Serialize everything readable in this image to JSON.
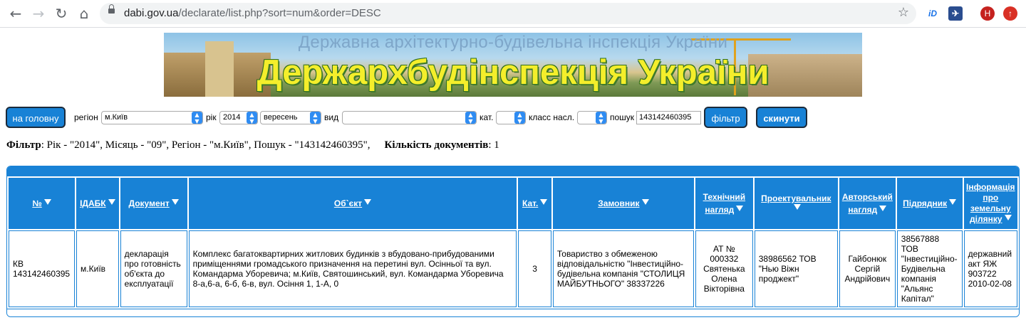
{
  "browser": {
    "url_host": "dabi.gov.ua",
    "url_path": "/declarate/list.php?sort=num&order=DESC",
    "ext_id": "iD",
    "ext_avatar": "H"
  },
  "banner": {
    "line1": "Державна архітектурно-будівельна інспекція України",
    "line2": "Держархбудінспекція України"
  },
  "filter_bar": {
    "home_button": "на головну",
    "region_label": "регіон",
    "region_value": "м.Київ",
    "year_label": "рік",
    "year_value": "2014",
    "month_value": "вересень",
    "kind_label": "вид",
    "kind_value": "",
    "cat_label": "кат.",
    "cat_value": "",
    "class_label": "класс насл.",
    "class_value": "",
    "search_label": "пошук",
    "search_value": "143142460395",
    "filter_button": "фільтр",
    "reset_button": "скинути"
  },
  "summary": {
    "filter_label": "Фільтр",
    "filter_text": ": Рік - \"2014\", Місяць - \"09\", Регіон - \"м.Київ\", Пошук - \"143142460395\",",
    "count_label": "Кількість документів",
    "count_text": ": 1"
  },
  "table": {
    "headers": [
      "№",
      "ІДАБК",
      "Документ",
      "Об`єкт",
      "Кат.",
      "Замовник",
      "Технічний нагляд",
      "Проектувальник",
      "Авторський нагляд",
      "Підрядник",
      "Інформація про земельну ділянку"
    ],
    "rows": [
      [
        "КВ 143142460395",
        "м.Київ",
        "декларація про готовність об'єкта до експлуатації",
        "Комплекс багатоквартирних житлових будинків з вбудовано-прибудованими приміщеннями громадського призначення на перетині вул. Осінньої та вул. Командарма Уборевича; м.Київ, Святошинський, вул. Командарма Уборевича 8-а,6-а, 6-б, 6-в, вул. Осіння 1, 1-А, 0",
        "3",
        "Товариство з обмеженою відповідальністю \"Інвестиційно-будівельна компанія \"СТОЛИЦЯ МАЙБУТНЬОГО\" 38337226",
        "АТ № 000332 Святенька Олена Вікторівна",
        "38986562 ТОВ \"Нью Віжн проджект\"",
        "Гайбонюк Сергій Андрійович",
        "38567888 ТОВ \"Інвестиційно-Будівельна компанія \"Альянс Капітал\"",
        "державний акт ЯЖ 903722 2010-02-08"
      ]
    ]
  }
}
